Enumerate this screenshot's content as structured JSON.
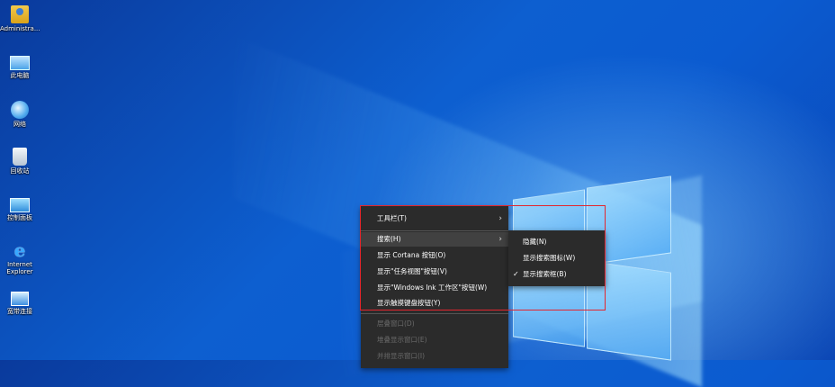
{
  "desktop": {
    "icons": [
      {
        "label": "Administra...",
        "icon": "user-folder-icon"
      },
      {
        "label": "此电脑",
        "icon": "computer-icon"
      },
      {
        "label": "网络",
        "icon": "network-icon"
      },
      {
        "label": "回收站",
        "icon": "recycle-bin-icon"
      },
      {
        "label": "控制面板",
        "icon": "control-panel-icon"
      },
      {
        "label": "Internet Explorer",
        "icon": "internet-explorer-icon"
      },
      {
        "label": "宽带连接",
        "icon": "broadband-connection-icon"
      }
    ]
  },
  "context_menu": {
    "items": [
      {
        "label": "工具栏(T)",
        "submenu": true
      },
      {
        "label": "搜索(H)",
        "submenu": true,
        "highlighted": true
      },
      {
        "label": "显示 Cortana 按钮(O)"
      },
      {
        "label": "显示\"任务视图\"按钮(V)"
      },
      {
        "label": "显示\"Windows Ink 工作区\"按钮(W)"
      },
      {
        "label": "显示触摸键盘按钮(Y)"
      },
      {
        "label": "层叠窗口(D)",
        "disabled": true
      },
      {
        "label": "堆叠显示窗口(E)",
        "disabled": true
      },
      {
        "label": "并排显示窗口(I)",
        "disabled": true
      }
    ],
    "submenu_arrow": "›"
  },
  "search_submenu": {
    "items": [
      {
        "label": "隐藏(N)"
      },
      {
        "label": "显示搜索图标(W)"
      },
      {
        "label": "显示搜索框(B)",
        "checked": true
      }
    ],
    "check_mark": "✓"
  },
  "colors": {
    "menu_bg": "#2b2b2b",
    "menu_highlight": "#414141",
    "annotation_red": "#e3262f"
  }
}
